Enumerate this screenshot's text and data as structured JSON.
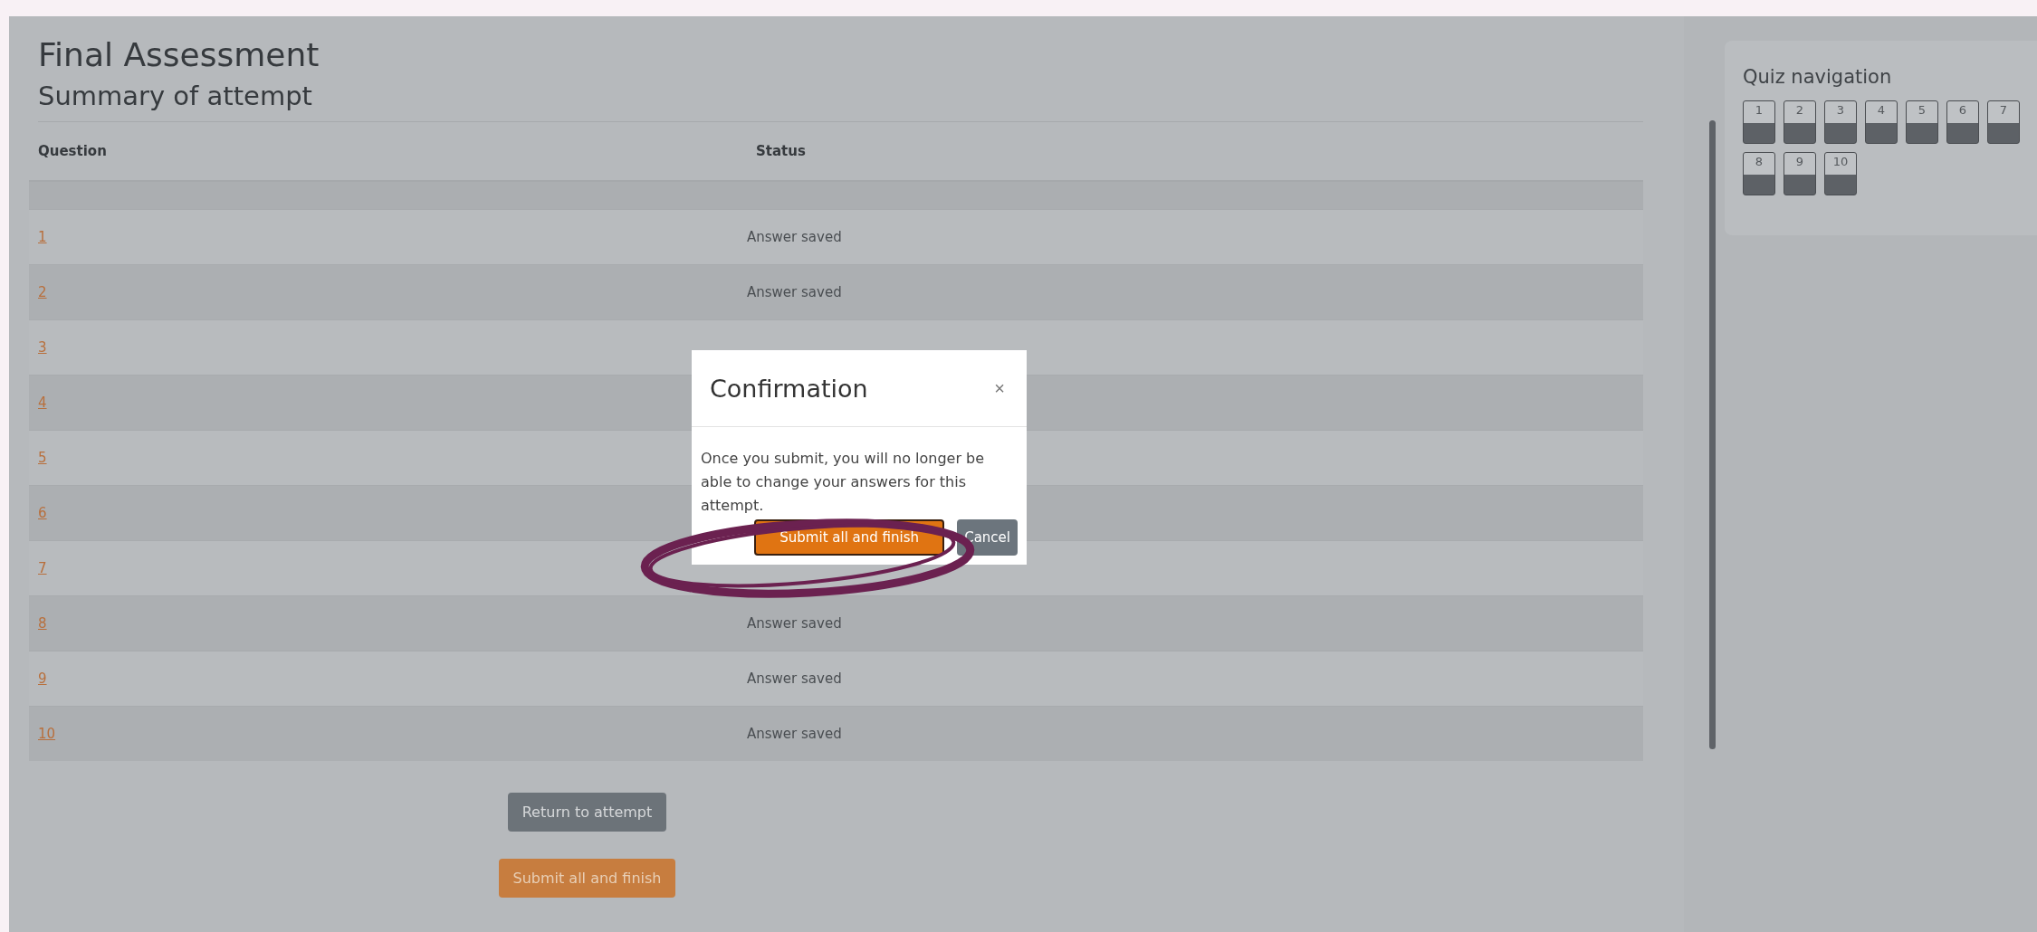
{
  "page": {
    "title": "Final Assessment",
    "subtitle": "Summary of attempt"
  },
  "table": {
    "columns": [
      "Question",
      "Status"
    ],
    "rows": [
      {
        "question": "1",
        "status": "Answer saved"
      },
      {
        "question": "2",
        "status": "Answer saved"
      },
      {
        "question": "3"
      },
      {
        "question": "4"
      },
      {
        "question": "5"
      },
      {
        "question": "6"
      },
      {
        "question": "7"
      },
      {
        "question": "8",
        "status": "Answer saved"
      },
      {
        "question": "9",
        "status": "Answer saved"
      },
      {
        "question": "10",
        "status": "Answer saved"
      }
    ]
  },
  "buttons": [
    {
      "label": "Return to attempt",
      "kind": "secondary"
    },
    {
      "label": "Submit all and finish",
      "kind": "primary"
    }
  ],
  "quiz_navigation": {
    "title": "Quiz navigation",
    "questions": [
      "1",
      "2",
      "3",
      "4",
      "5",
      "6",
      "7",
      "8",
      "9",
      "10"
    ]
  },
  "modal": {
    "title": "Confirmation",
    "close": "×",
    "message": "Once you submit, you will no longer be able to change your answers for this attempt.",
    "buttons": [
      {
        "label": "Submit all and finish",
        "kind": "primary"
      },
      {
        "label": "Cancel",
        "kind": "secondary"
      }
    ]
  }
}
